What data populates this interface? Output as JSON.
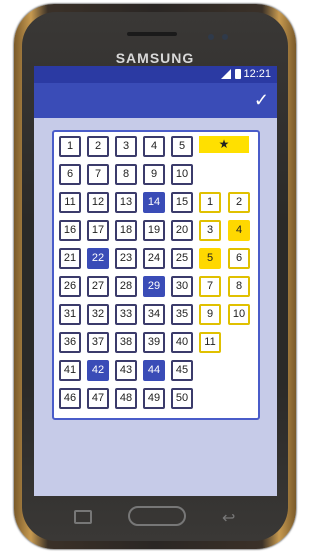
{
  "device": {
    "brand": "SAMSUNG"
  },
  "status": {
    "time": "12:21"
  },
  "appbar": {
    "icon": "check-icon",
    "check_glyph": "✓"
  },
  "main_numbers": {
    "values": [
      1,
      2,
      3,
      4,
      5,
      6,
      7,
      8,
      9,
      10,
      11,
      12,
      13,
      14,
      15,
      16,
      17,
      18,
      19,
      20,
      21,
      22,
      23,
      24,
      25,
      26,
      27,
      28,
      29,
      30,
      31,
      32,
      33,
      34,
      35,
      36,
      37,
      38,
      39,
      40,
      41,
      42,
      43,
      44,
      45,
      46,
      47,
      48,
      49,
      50
    ],
    "selected": [
      14,
      22,
      29,
      42,
      44
    ]
  },
  "bonus_numbers": {
    "header_symbol": "★",
    "values": [
      1,
      2,
      3,
      4,
      5,
      6,
      7,
      8,
      9,
      10,
      11
    ],
    "selected": [
      4,
      5
    ]
  },
  "colors": {
    "primary": "#3a4cb7",
    "status_bar": "#2b3aa3",
    "accent_star": "#ffd800",
    "screen_bg": "#c6cbe8"
  }
}
